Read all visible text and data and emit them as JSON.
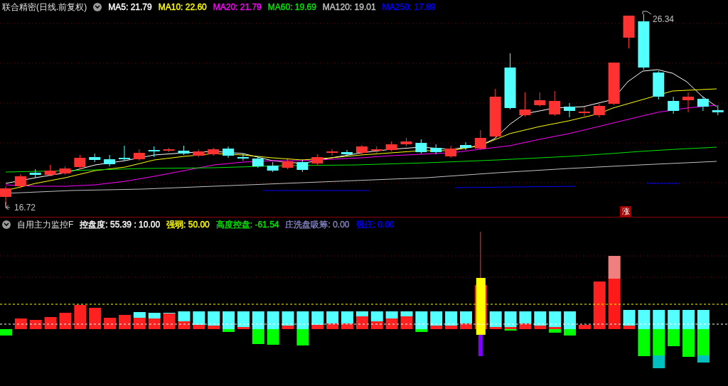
{
  "price_panel": {
    "title": "联合精密(日线.前复权)",
    "legend": [
      {
        "text": "MA5: 21.79",
        "color": "#ffffff"
      },
      {
        "text": "MA10: 22.60",
        "color": "#ffff00"
      },
      {
        "text": "MA20: 21.79",
        "color": "#ff00ff"
      },
      {
        "text": "MA60: 19.69",
        "color": "#00e600"
      },
      {
        "text": "MA120: 19.01",
        "color": "#c0c0c0"
      },
      {
        "text": "MA250: 17.89",
        "color": "#0000ff"
      }
    ],
    "high_label": "26.34",
    "low_label": "16.72",
    "badge": "涨"
  },
  "indicator_panel": {
    "title": "自用主力监控F",
    "legend": [
      {
        "text": "控盘度: 55.39 : 10.00",
        "color": "#ffffff"
      },
      {
        "text": "强弱: 50.00",
        "color": "#ffff00"
      },
      {
        "text": "高度控盘: -61.54",
        "color": "#00e600"
      },
      {
        "text": "庄洗盘吸筹: 0.00",
        "color": "#8080c0"
      },
      {
        "text": "强庄: 0.00",
        "color": "#0000ff"
      }
    ]
  }
}
